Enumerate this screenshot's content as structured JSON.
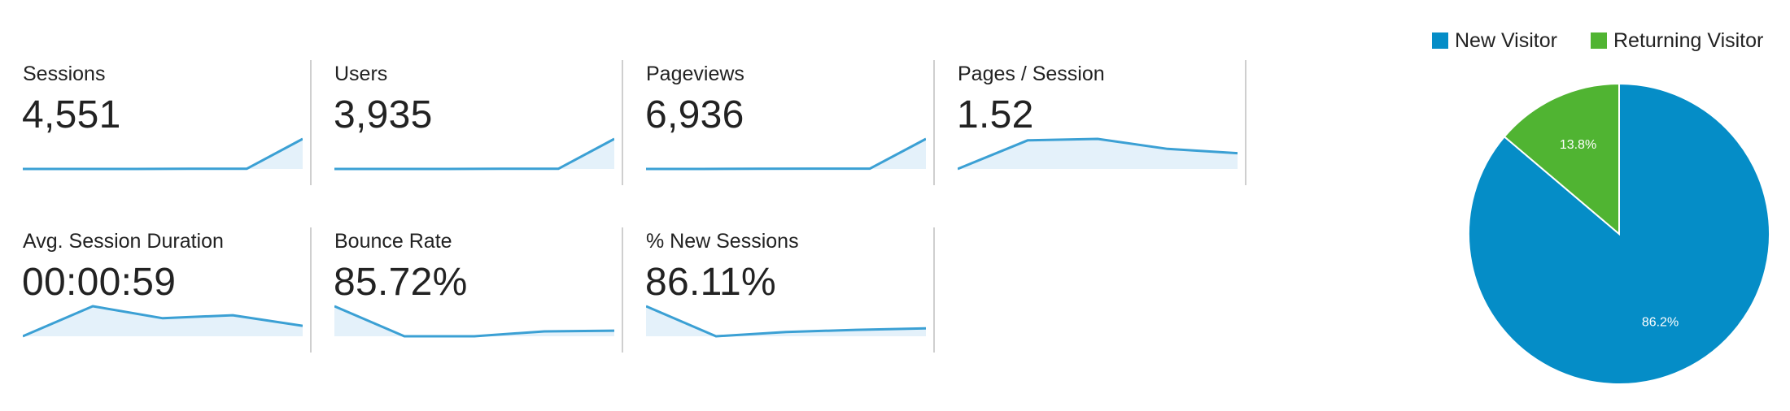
{
  "metrics": [
    {
      "label": "Sessions",
      "value": "4,551",
      "trend": [
        0.5,
        0.5,
        0.5,
        0.7,
        0.7,
        45
      ]
    },
    {
      "label": "Users",
      "value": "3,935",
      "trend": [
        0.5,
        0.5,
        0.5,
        0.7,
        0.7,
        40
      ]
    },
    {
      "label": "Pageviews",
      "value": "6,936",
      "trend": [
        0.5,
        0.5,
        0.8,
        1.2,
        1.2,
        60
      ]
    },
    {
      "label": "Pages / Session",
      "value": "1.52",
      "trend": [
        1.35,
        1.55,
        1.56,
        1.49,
        1.46
      ]
    },
    {
      "label": "Avg. Session Duration",
      "value": "00:00:59",
      "trend": [
        0,
        1,
        0.6,
        0.7,
        0.35
      ]
    },
    {
      "label": "Bounce Rate",
      "value": "85.72%",
      "trend": [
        90,
        85.7,
        85.7,
        86.4,
        86.5
      ]
    },
    {
      "label": "% New Sessions",
      "value": "86.11%",
      "trend": [
        90,
        85.8,
        86.4,
        86.7,
        86.9
      ]
    }
  ],
  "chart_data": {
    "type": "pie",
    "legend_position": "top",
    "slices": [
      {
        "label": "New Visitor",
        "value": 86.2,
        "display": "86.2%",
        "color": "#058dc7"
      },
      {
        "label": "Returning Visitor",
        "value": 13.8,
        "display": "13.8%",
        "color": "#50b432"
      }
    ]
  },
  "colors": {
    "sparkline": "#3ba0d4",
    "sparkline_fill": "#e4f1fa",
    "divider": "#cfcfcf"
  }
}
